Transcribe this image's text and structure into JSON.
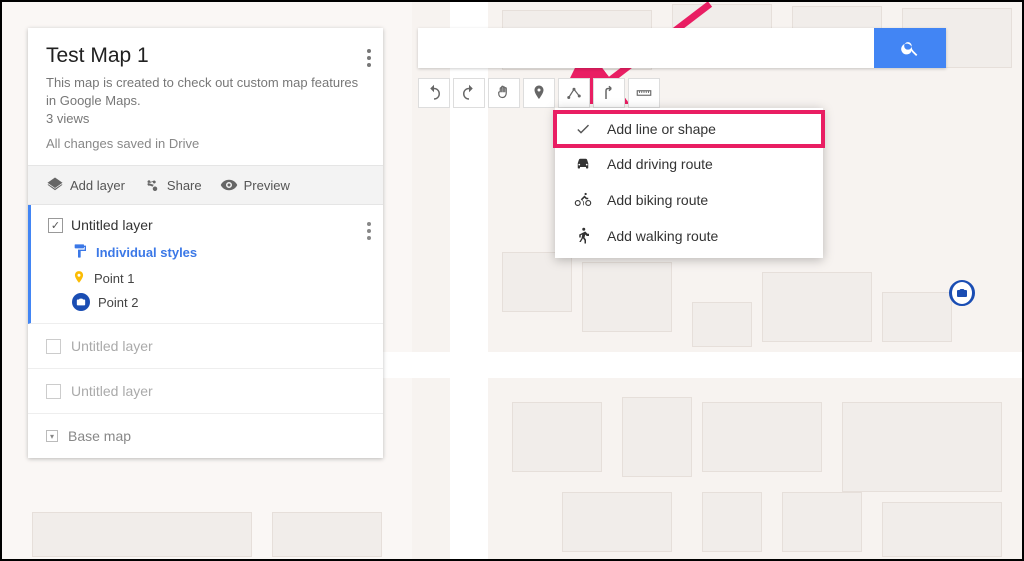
{
  "panel": {
    "title": "Test Map 1",
    "description": "This map is created to check out custom map features in Google Maps.",
    "views": "3 views",
    "saved": "All changes saved in Drive",
    "actions": {
      "add_layer": "Add layer",
      "share": "Share",
      "preview": "Preview"
    },
    "active_layer": {
      "name": "Untitled layer",
      "style_label": "Individual styles",
      "points": [
        "Point 1",
        "Point 2"
      ]
    },
    "inactive_layers": [
      "Untitled layer",
      "Untitled layer"
    ],
    "base_map": "Base map"
  },
  "search": {
    "placeholder": ""
  },
  "dropdown": {
    "items": [
      "Add line or shape",
      "Add driving route",
      "Add biking route",
      "Add walking route"
    ]
  },
  "toolbar_icons": [
    "undo",
    "redo",
    "hand",
    "marker",
    "line",
    "directions",
    "measure"
  ]
}
